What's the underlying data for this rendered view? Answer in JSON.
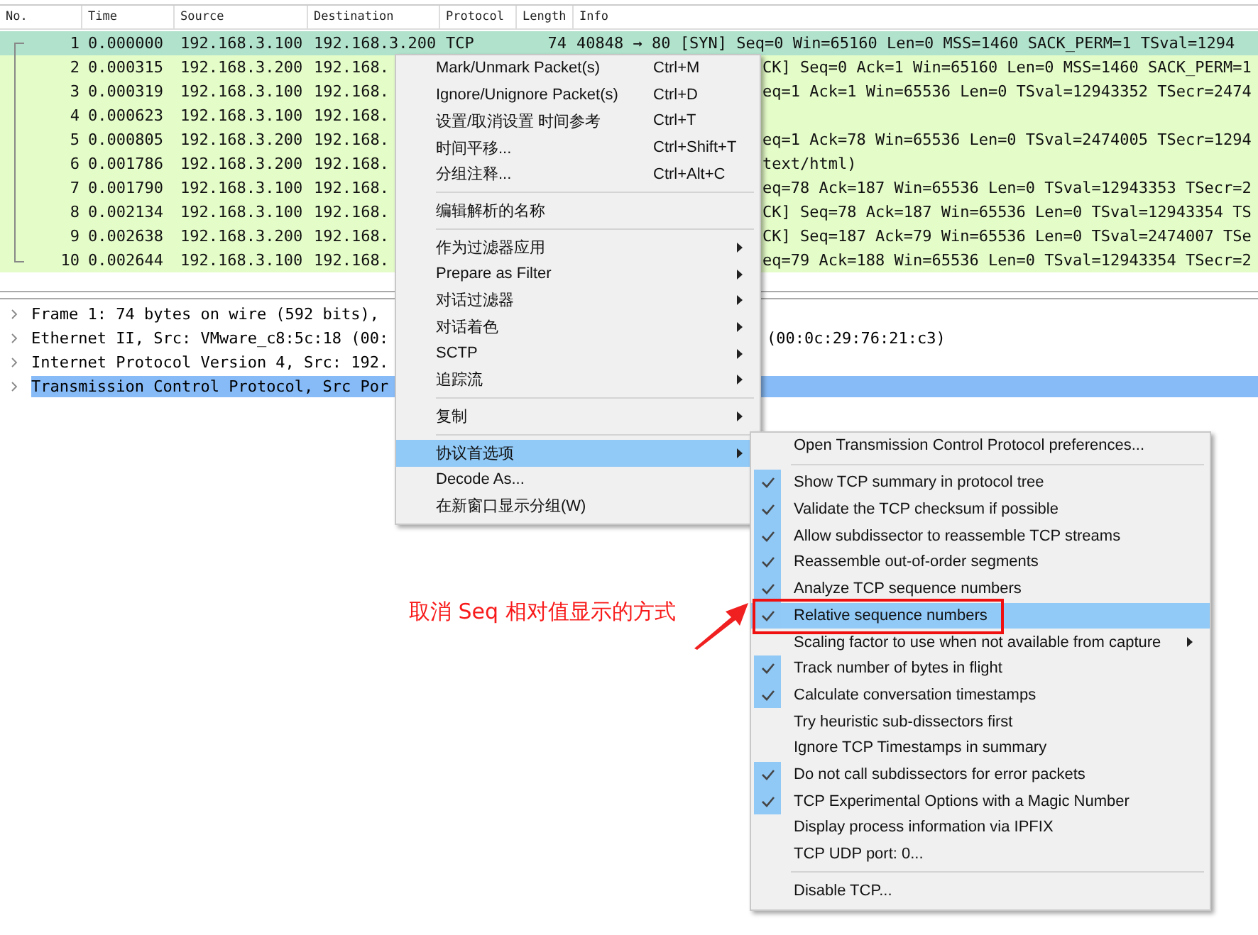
{
  "packet_list": {
    "columns": [
      "No.",
      "Time",
      "Source",
      "Destination",
      "Protocol",
      "Length",
      "Info"
    ],
    "rows": [
      {
        "no": "1",
        "time": "0.000000",
        "source": "192.168.3.100",
        "destination": "192.168.3.200",
        "protocol": "TCP",
        "length": "74",
        "info": "40848 → 80 [SYN] Seq=0 Win=65160 Len=0 MSS=1460 SACK_PERM=1 TSval=1294",
        "selected": true
      },
      {
        "no": "2",
        "time": "0.000315",
        "source": "192.168.3.200",
        "destination": "192.168.",
        "info_tail": "CK] Seq=0 Ack=1 Win=65160 Len=0 MSS=1460 SACK_PERM=1",
        "selected": false
      },
      {
        "no": "3",
        "time": "0.000319",
        "source": "192.168.3.100",
        "destination": "192.168.",
        "info_tail": "eq=1 Ack=1 Win=65536 Len=0 TSval=12943352 TSecr=2474",
        "selected": false
      },
      {
        "no": "4",
        "time": "0.000623",
        "source": "192.168.3.100",
        "destination": "192.168.",
        "selected": false
      },
      {
        "no": "5",
        "time": "0.000805",
        "source": "192.168.3.200",
        "destination": "192.168.",
        "info_tail": "eq=1 Ack=78 Win=65536 Len=0 TSval=2474005 TSecr=1294",
        "selected": false
      },
      {
        "no": "6",
        "time": "0.001786",
        "source": "192.168.3.200",
        "destination": "192.168.",
        "info_tail": "text/html)",
        "selected": false
      },
      {
        "no": "7",
        "time": "0.001790",
        "source": "192.168.3.100",
        "destination": "192.168.",
        "info_tail": "eq=78 Ack=187 Win=65536 Len=0 TSval=12943353 TSecr=2",
        "selected": false
      },
      {
        "no": "8",
        "time": "0.002134",
        "source": "192.168.3.100",
        "destination": "192.168.",
        "info_tail": "CK] Seq=78 Ack=187 Win=65536 Len=0 TSval=12943354 TS",
        "selected": false
      },
      {
        "no": "9",
        "time": "0.002638",
        "source": "192.168.3.200",
        "destination": "192.168.",
        "info_tail": "CK] Seq=187 Ack=79 Win=65536 Len=0 TSval=2474007 TSe",
        "selected": false
      },
      {
        "no": "10",
        "time": "0.002644",
        "source": "192.168.3.100",
        "destination": "192.168.",
        "info_tail": "eq=79 Ack=188 Win=65536 Len=0 TSval=12943354 TSecr=2",
        "selected": false
      }
    ]
  },
  "details": {
    "rows": [
      {
        "text": "Frame 1: 74 bytes on wire (592 bits),",
        "selected": false
      },
      {
        "text": "Ethernet II, Src: VMware_c8:5c:18 (00:",
        "tail": "(00:0c:29:76:21:c3)",
        "selected": false
      },
      {
        "text": "Internet Protocol Version 4, Src: 192.",
        "selected": false
      },
      {
        "text": "Transmission Control Protocol, Src Por",
        "selected": true
      }
    ]
  },
  "context_menu": {
    "items": [
      {
        "kind": "item",
        "label": "Mark/Unmark Packet(s)",
        "shortcut": "Ctrl+M",
        "submenu": false,
        "selected": false
      },
      {
        "kind": "item",
        "label": "Ignore/Unignore Packet(s)",
        "shortcut": "Ctrl+D",
        "submenu": false,
        "selected": false
      },
      {
        "kind": "item",
        "label": "设置/取消设置 时间参考",
        "shortcut": "Ctrl+T",
        "submenu": false,
        "selected": false
      },
      {
        "kind": "item",
        "label": "时间平移...",
        "shortcut": "Ctrl+Shift+T",
        "submenu": false,
        "selected": false
      },
      {
        "kind": "item",
        "label": "分组注释...",
        "shortcut": "Ctrl+Alt+C",
        "submenu": false,
        "selected": false
      },
      {
        "kind": "separator"
      },
      {
        "kind": "item",
        "label": "编辑解析的名称",
        "submenu": false,
        "selected": false
      },
      {
        "kind": "separator"
      },
      {
        "kind": "item",
        "label": "作为过滤器应用",
        "submenu": true,
        "selected": false
      },
      {
        "kind": "item",
        "label": "Prepare as Filter",
        "submenu": true,
        "selected": false
      },
      {
        "kind": "item",
        "label": "对话过滤器",
        "submenu": true,
        "selected": false
      },
      {
        "kind": "item",
        "label": "对话着色",
        "submenu": true,
        "selected": false
      },
      {
        "kind": "item",
        "label": "SCTP",
        "submenu": true,
        "selected": false
      },
      {
        "kind": "item",
        "label": "追踪流",
        "submenu": true,
        "selected": false
      },
      {
        "kind": "separator"
      },
      {
        "kind": "item",
        "label": "复制",
        "submenu": true,
        "selected": false
      },
      {
        "kind": "separator"
      },
      {
        "kind": "item",
        "label": "协议首选项",
        "submenu": true,
        "selected": true
      },
      {
        "kind": "item",
        "label": "Decode As...",
        "submenu": false,
        "selected": false
      },
      {
        "kind": "item",
        "label": "在新窗口显示分组(W)",
        "submenu": false,
        "selected": false
      }
    ]
  },
  "preferences_submenu": {
    "items": [
      {
        "kind": "item",
        "label": "Open Transmission Control Protocol preferences...",
        "checked": false,
        "submenu": false,
        "selected": false
      },
      {
        "kind": "separator"
      },
      {
        "kind": "item",
        "label": "Show TCP summary in protocol tree",
        "checked": true,
        "submenu": false,
        "selected": false
      },
      {
        "kind": "item",
        "label": "Validate the TCP checksum if possible",
        "checked": true,
        "submenu": false,
        "selected": false
      },
      {
        "kind": "item",
        "label": "Allow subdissector to reassemble TCP streams",
        "checked": true,
        "submenu": false,
        "selected": false
      },
      {
        "kind": "item",
        "label": "Reassemble out-of-order segments",
        "checked": true,
        "submenu": false,
        "selected": false
      },
      {
        "kind": "item",
        "label": "Analyze TCP sequence numbers",
        "checked": true,
        "submenu": false,
        "selected": false
      },
      {
        "kind": "item",
        "label": "Relative sequence numbers",
        "checked": true,
        "submenu": false,
        "selected": true
      },
      {
        "kind": "item",
        "label": "Scaling factor to use when not available from capture",
        "checked": false,
        "submenu": true,
        "selected": false
      },
      {
        "kind": "item",
        "label": "Track number of bytes in flight",
        "checked": true,
        "submenu": false,
        "selected": false
      },
      {
        "kind": "item",
        "label": "Calculate conversation timestamps",
        "checked": true,
        "submenu": false,
        "selected": false
      },
      {
        "kind": "item",
        "label": "Try heuristic sub-dissectors first",
        "checked": false,
        "submenu": false,
        "selected": false
      },
      {
        "kind": "item",
        "label": "Ignore TCP Timestamps in summary",
        "checked": false,
        "submenu": false,
        "selected": false
      },
      {
        "kind": "item",
        "label": "Do not call subdissectors for error packets",
        "checked": true,
        "submenu": false,
        "selected": false
      },
      {
        "kind": "item",
        "label": "TCP Experimental Options with a Magic Number",
        "checked": true,
        "submenu": false,
        "selected": false
      },
      {
        "kind": "item",
        "label": "Display process information via IPFIX",
        "checked": false,
        "submenu": false,
        "selected": false
      },
      {
        "kind": "item",
        "label": "TCP UDP port: 0...",
        "checked": false,
        "submenu": false,
        "selected": false
      },
      {
        "kind": "separator"
      },
      {
        "kind": "item",
        "label": "Disable TCP...",
        "checked": false,
        "submenu": false,
        "selected": false
      }
    ]
  },
  "annotation": {
    "text": "取消 Seq 相对值显示的方式"
  }
}
